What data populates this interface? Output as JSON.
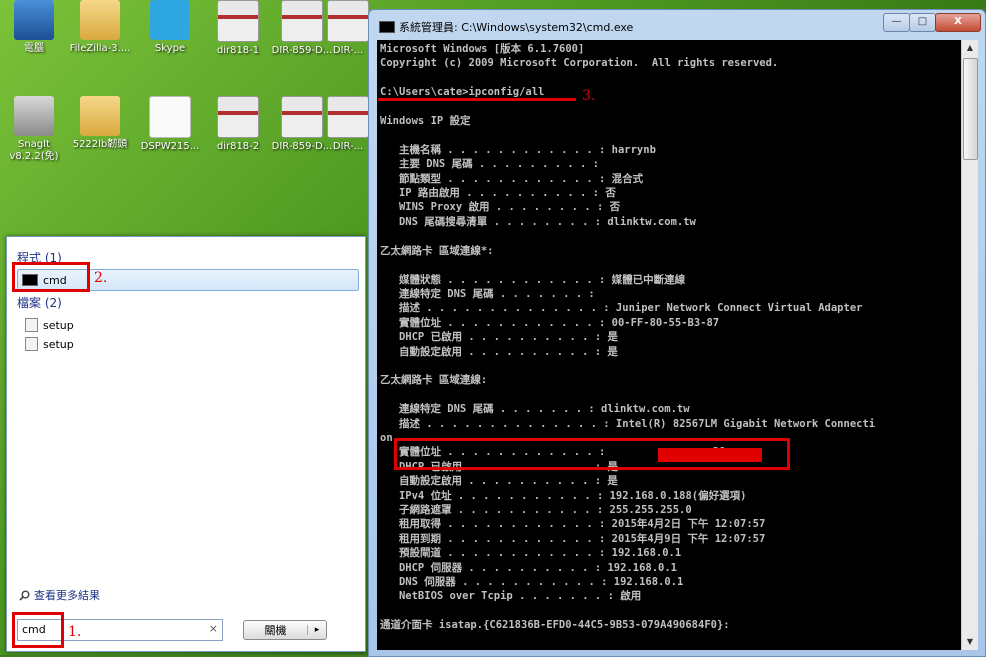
{
  "desktop": {
    "icons": [
      {
        "label": "電腦",
        "icon": "computer-icon"
      },
      {
        "label": "FileZilla-3....",
        "icon": "folder-icon"
      },
      {
        "label": "Skype",
        "icon": "skype-icon"
      },
      {
        "label": "dir818-1",
        "icon": "screenshot-file-icon"
      },
      {
        "label": "DIR-859-D...",
        "icon": "screenshot-file-icon"
      },
      {
        "label": "DIR-...",
        "icon": "screenshot-file-icon"
      },
      {
        "label": "SnagIt v8.2.2(免)",
        "icon": "snagit-icon"
      },
      {
        "label": "5222lb韌頭",
        "icon": "folder-icon"
      },
      {
        "label": "DSPW215...",
        "icon": "document-icon"
      },
      {
        "label": "dir818-2",
        "icon": "screenshot-file-icon"
      },
      {
        "label": "DIR-859-D...",
        "icon": "screenshot-file-icon"
      },
      {
        "label": "DIR-...",
        "icon": "screenshot-file-icon"
      }
    ]
  },
  "start_menu": {
    "programs_header": "程式 (1)",
    "program_item": "cmd",
    "files_header": "檔案 (2)",
    "file_items": [
      "setup",
      "setup"
    ],
    "more_results": "查看更多結果",
    "search_value": "cmd",
    "clear_glyph": "×",
    "shutdown_label": "關機",
    "shutdown_arrow": "▸"
  },
  "cmd_window": {
    "title": "系統管理員: C:\\Windows\\system32\\cmd.exe",
    "minimize": "—",
    "maximize": "□",
    "close": "X",
    "lines": [
      "Microsoft Windows [版本 6.1.7600]",
      "Copyright (c) 2009 Microsoft Corporation.  All rights reserved.",
      "",
      "C:\\Users\\cate>ipconfig/all",
      "",
      "Windows IP 設定",
      "",
      "   主機名稱 . . . . . . . . . . . . : harrynb",
      "   主要 DNS 尾碼 . . . . . . . . . :",
      "   節點類型 . . . . . . . . . . . . : 混合式",
      "   IP 路由啟用 . . . . . . . . . . : 否",
      "   WINS Proxy 啟用 . . . . . . . . : 否",
      "   DNS 尾碼搜尋清單 . . . . . . . . : dlinktw.com.tw",
      "",
      "乙太網路卡 區域連線*:",
      "",
      "   媒體狀態 . . . . . . . . . . . . : 媒體已中斷連線",
      "   連線特定 DNS 尾碼 . . . . . . . :",
      "   描述 . . . . . . . . . . . . . . : Juniper Network Connect Virtual Adapter",
      "   實體位址 . . . . . . . . . . . . : 00-FF-80-55-B3-87",
      "   DHCP 已啟用 . . . . . . . . . . : 是",
      "   自動設定啟用 . . . . . . . . . . : 是",
      "",
      "乙太網路卡 區域連線:",
      "",
      "   連線特定 DNS 尾碼 . . . . . . . : dlinktw.com.tw",
      "   描述 . . . . . . . . . . . . . . : Intel(R) 82567LM Gigabit Network Connecti",
      "on",
      "   實體位址 . . . . . . . . . . . . :                -28",
      "   DHCP 已啟用 . . . . . . . . . . : 是",
      "   自動設定啟用 . . . . . . . . . . : 是",
      "   IPv4 位址 . . . . . . . . . . . : 192.168.0.188(偏好選項)",
      "   子網路遮罩 . . . . . . . . . . . : 255.255.255.0",
      "   租用取得 . . . . . . . . . . . . : 2015年4月2日 下午 12:07:57",
      "   租用到期 . . . . . . . . . . . . : 2015年4月9日 下午 12:07:57",
      "   預設閘道 . . . . . . . . . . . . : 192.168.0.1",
      "   DHCP 伺服器 . . . . . . . . . . : 192.168.0.1",
      "   DNS 伺服器 . . . . . . . . . . . : 192.168.0.1",
      "   NetBIOS over Tcpip . . . . . . . : 啟用",
      "",
      "通道介面卡 isatap.{C621836B-EFD0-44C5-9B53-079A490684F0}:"
    ]
  },
  "annotations": {
    "step1": "1.",
    "step2": "2.",
    "step3": "3.",
    "color": "#e00000"
  }
}
